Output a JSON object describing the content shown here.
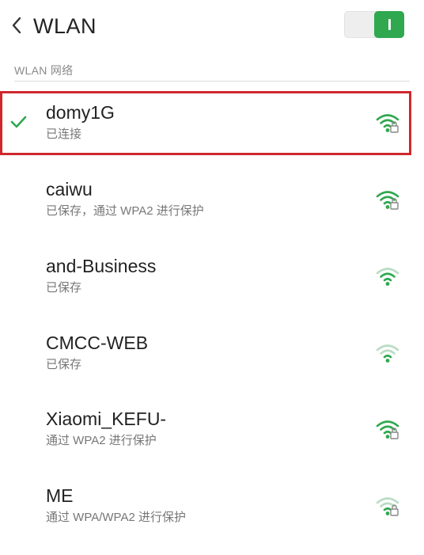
{
  "header": {
    "title": "WLAN",
    "back_icon": "chevron-left-icon",
    "toggle": {
      "state": "on",
      "color": "#2fa84f"
    }
  },
  "section": {
    "label": "WLAN 网络"
  },
  "networks": [
    {
      "name": "domy1G",
      "status": "已连接",
      "connected": true,
      "signal": "strong",
      "secured": true
    },
    {
      "name": "caiwu",
      "status": "已保存，通过 WPA2 进行保护",
      "connected": false,
      "signal": "strong",
      "secured": true
    },
    {
      "name": "and-Business",
      "status": "已保存",
      "connected": false,
      "signal": "medium",
      "secured": false
    },
    {
      "name": "CMCC-WEB",
      "status": "已保存",
      "connected": false,
      "signal": "weak",
      "secured": false
    },
    {
      "name": "Xiaomi_KEFU-",
      "status": "通过 WPA2 进行保护",
      "connected": false,
      "signal": "strong",
      "secured": true
    },
    {
      "name": "ME",
      "status": "通过 WPA/WPA2 进行保护",
      "connected": false,
      "signal": "weak",
      "secured": true
    }
  ],
  "colors": {
    "accent": "#2fa84f",
    "highlight": "#d0272e",
    "faded": "#b9dcc3"
  }
}
